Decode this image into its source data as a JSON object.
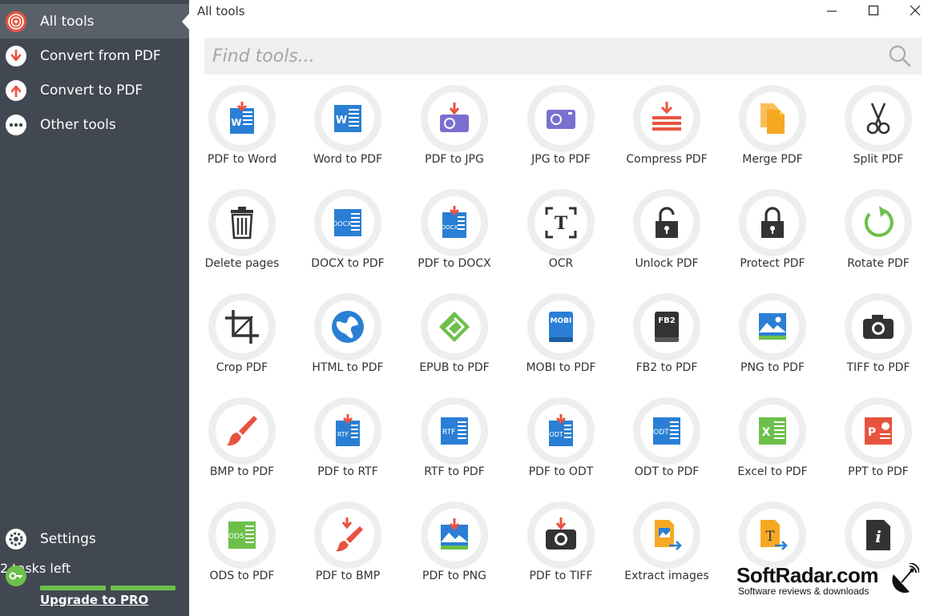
{
  "sidebar": {
    "items": [
      {
        "label": "All tools",
        "icon": "spiral-icon"
      },
      {
        "label": "Convert from PDF",
        "icon": "arrow-down-icon"
      },
      {
        "label": "Convert to PDF",
        "icon": "arrow-up-icon"
      },
      {
        "label": "Other tools",
        "icon": "ellipsis-icon"
      }
    ],
    "settings_label": "Settings",
    "tasks_label": "2 tasks left",
    "upgrade_label": "Upgrade to PRO"
  },
  "header": {
    "title": "All tools"
  },
  "search": {
    "placeholder": "Find tools..."
  },
  "tools": [
    {
      "label": "PDF to Word"
    },
    {
      "label": "Word to PDF"
    },
    {
      "label": "PDF to JPG"
    },
    {
      "label": "JPG to PDF"
    },
    {
      "label": "Compress PDF"
    },
    {
      "label": "Merge PDF"
    },
    {
      "label": "Split PDF"
    },
    {
      "label": "Delete pages"
    },
    {
      "label": "DOCX to PDF"
    },
    {
      "label": "PDF to DOCX"
    },
    {
      "label": "OCR"
    },
    {
      "label": "Unlock PDF"
    },
    {
      "label": "Protect PDF"
    },
    {
      "label": "Rotate PDF"
    },
    {
      "label": "Crop PDF"
    },
    {
      "label": "HTML to PDF"
    },
    {
      "label": "EPUB to PDF"
    },
    {
      "label": "MOBI to PDF"
    },
    {
      "label": "FB2 to PDF"
    },
    {
      "label": "PNG to PDF"
    },
    {
      "label": "TIFF to PDF"
    },
    {
      "label": "BMP to PDF"
    },
    {
      "label": "PDF to RTF"
    },
    {
      "label": "RTF to PDF"
    },
    {
      "label": "PDF to ODT"
    },
    {
      "label": "ODT to PDF"
    },
    {
      "label": "Excel to PDF"
    },
    {
      "label": "PPT to PDF"
    },
    {
      "label": "ODS to PDF"
    },
    {
      "label": "PDF to BMP"
    },
    {
      "label": "PDF to PNG"
    },
    {
      "label": "PDF to TIFF"
    },
    {
      "label": "Extract images"
    },
    {
      "label": ""
    },
    {
      "label": ""
    }
  ],
  "icon_text": {
    "docx": "DOCX",
    "rtf": "RTF",
    "odt": "ODT",
    "mobi": "MOBI",
    "fb2": "FB2",
    "ods": "ODS",
    "w": "W",
    "x": "X",
    "p": "P",
    "t": "T",
    "i": "i"
  },
  "watermark": {
    "title": "SoftRadar.com",
    "subtitle": "Software reviews & downloads"
  },
  "colors": {
    "sidebar": "#424851",
    "active": "#5a6069",
    "accent_red": "#e8533f",
    "blue": "#2a7fd4",
    "green": "#6cc04a",
    "orange": "#f7a823"
  }
}
